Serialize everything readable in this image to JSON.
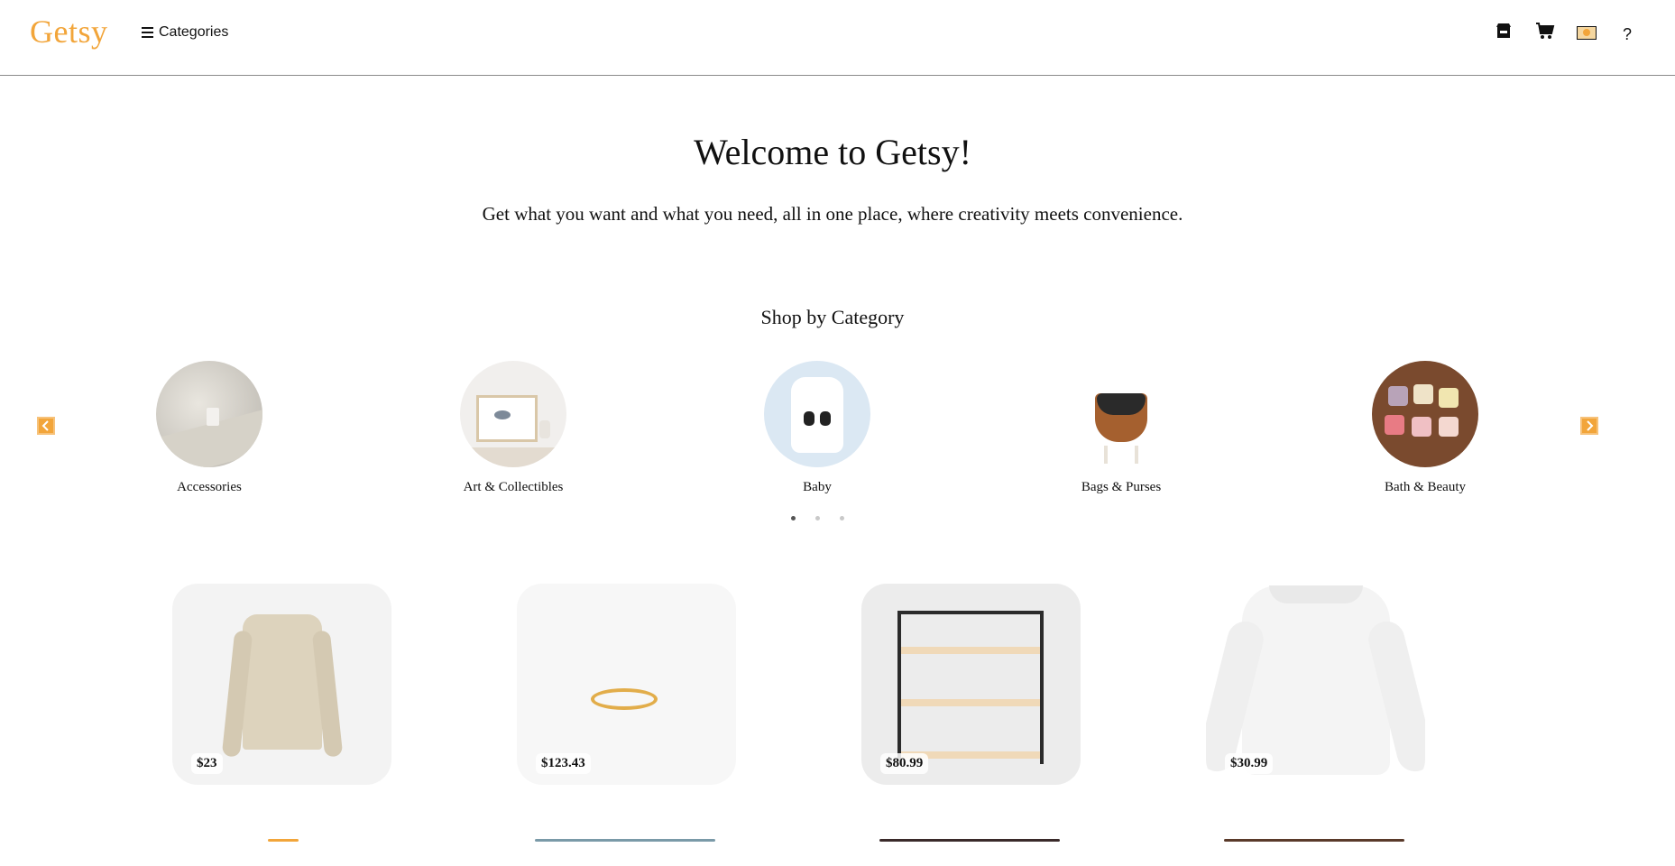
{
  "header": {
    "logo": "Getsy",
    "categories_label": "Categories",
    "icons": [
      "store-icon",
      "cart-icon",
      "profile-icon",
      "help-icon"
    ],
    "help_label": "?"
  },
  "hero": {
    "title": "Welcome to Getsy!",
    "subtitle": "Get what you want and what you need, all in one place, where creativity meets convenience."
  },
  "categories": {
    "heading": "Shop by Category",
    "items": [
      {
        "label": "Accessories"
      },
      {
        "label": "Art & Collectibles"
      },
      {
        "label": "Baby"
      },
      {
        "label": "Bags & Purses"
      },
      {
        "label": "Bath & Beauty"
      }
    ],
    "page_count": 3,
    "active_page": 1
  },
  "products": [
    {
      "price": "$23"
    },
    {
      "price": "$123.43"
    },
    {
      "price": "$80.99"
    },
    {
      "price": "$30.99"
    }
  ],
  "colors": {
    "brand": "#f2a53a",
    "border": "#8a8a8a"
  }
}
